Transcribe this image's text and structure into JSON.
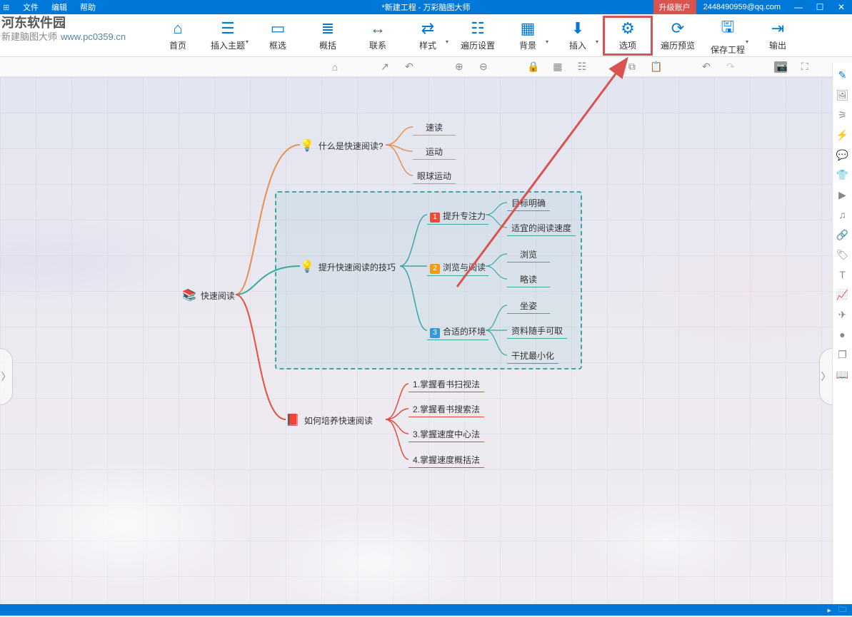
{
  "titlebar": {
    "menus": [
      "文件",
      "编辑",
      "帮助"
    ],
    "title": "*新建工程 - 万彩脑图大师",
    "upgrade": "升级账户",
    "user": "2448490959@qq.com"
  },
  "watermark": {
    "line1": "河东软件园",
    "line2": "新建脑图大师",
    "url": "www.pc0359.cn"
  },
  "toolbar": [
    {
      "id": "home",
      "icon": "⌂",
      "label": "首页"
    },
    {
      "id": "insert-topic",
      "icon": "☰",
      "label": "插入主题",
      "dd": true
    },
    {
      "id": "frame",
      "icon": "▭",
      "label": "框选"
    },
    {
      "id": "summary",
      "icon": "≣",
      "label": "概括"
    },
    {
      "id": "relation",
      "icon": "↔",
      "label": "联系"
    },
    {
      "id": "style",
      "icon": "⇄",
      "label": "样式",
      "dd": true
    },
    {
      "id": "traverse-set",
      "icon": "☷",
      "label": "遍历设置"
    },
    {
      "id": "background",
      "icon": "▦",
      "label": "背景",
      "dd": true
    },
    {
      "id": "insert",
      "icon": "⬇",
      "label": "插入",
      "dd": true
    },
    {
      "id": "options",
      "icon": "⚙",
      "label": "选项",
      "hl": true
    },
    {
      "id": "traverse-preview",
      "icon": "⟳",
      "label": "遍历预览"
    },
    {
      "id": "save",
      "icon": "🖫",
      "label": "保存工程",
      "dd": true
    },
    {
      "id": "export",
      "icon": "⇥",
      "label": "输出"
    }
  ],
  "subtoolbar_icons": [
    "home",
    "share",
    "undo-sep",
    "zoom-in",
    "zoom-out",
    "lock",
    "grid",
    "align",
    "copy",
    "paste",
    "undo",
    "redo",
    "camera",
    "fullscreen"
  ],
  "sidepanel_icons": [
    "edit",
    "image",
    "branch",
    "flash",
    "comment",
    "shirt",
    "play",
    "music",
    "link",
    "tag",
    "text",
    "chart",
    "send",
    "ball",
    "layers",
    "book"
  ],
  "mindmap": {
    "root": {
      "icon": "📚",
      "label": "快速阅读"
    },
    "b1": {
      "icon": "💡",
      "label": "什么是快速阅读?"
    },
    "b1_leaves": [
      "速读",
      "运动",
      "眼球运动"
    ],
    "b2": {
      "icon": "💡",
      "label": "提升快速阅读的技巧"
    },
    "b2_sub1": {
      "num": "1",
      "label": "提升专注力"
    },
    "b2_sub1_leaves": [
      "目标明确",
      "适宜的阅读速度"
    ],
    "b2_sub2": {
      "num": "2",
      "label": "浏览与阅读"
    },
    "b2_sub2_leaves": [
      "浏览",
      "略读"
    ],
    "b2_sub3": {
      "num": "3",
      "label": "合适的环境"
    },
    "b2_sub3_leaves": [
      "坐姿",
      "资料随手可取",
      "干扰最小化"
    ],
    "b3": {
      "icon": "📕",
      "label": "如何培养快速阅读"
    },
    "b3_leaves": [
      "1.掌握看书扫视法",
      "2.掌握看书搜索法",
      "3.掌握速度中心法",
      "4.掌握速度概括法"
    ]
  }
}
